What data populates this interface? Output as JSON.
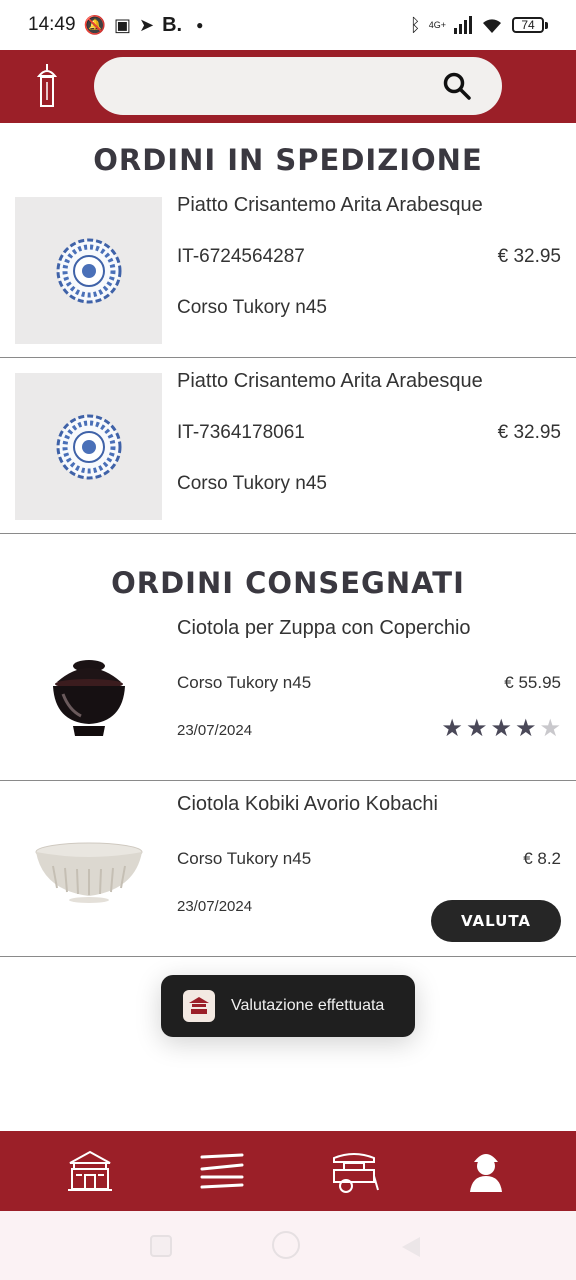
{
  "status_bar": {
    "time": "14:49",
    "network": "4G+",
    "battery": "74"
  },
  "search": {
    "placeholder": ""
  },
  "sections": {
    "shipping_title": "ORDINI IN SPEDIZIONE",
    "delivered_title": "ORDINI CONSEGNATI"
  },
  "shipping_orders": [
    {
      "name": "Piatto Crisantemo Arita Arabesque",
      "code": "IT-6724564287",
      "price": "€ 32.95",
      "address": "Corso Tukory n45"
    },
    {
      "name": "Piatto Crisantemo Arita Arabesque",
      "code": "IT-7364178061",
      "price": "€ 32.95",
      "address": "Corso Tukory n45"
    }
  ],
  "delivered_orders": [
    {
      "name": "Ciotola per Zuppa con Coperchio",
      "address": "Corso Tukory n45",
      "price": "€ 55.95",
      "date": "23/07/2024",
      "rating": 4,
      "rating_max": 5
    },
    {
      "name": "Ciotola Kobiki Avorio Kobachi",
      "address": "Corso Tukory n45",
      "price": "€ 8.2",
      "date": "23/07/2024",
      "rate_button": "VALUTA"
    }
  ],
  "toast": {
    "text": "Valutazione effettuata"
  },
  "colors": {
    "brand_red": "#9b1f28",
    "star_on": "#4a4858",
    "star_off": "#c9c8cc",
    "button_dark": "#262626"
  },
  "icons": {
    "logo": "lantern-logo-icon",
    "search": "search-icon",
    "nav": [
      "house-icon",
      "chopsticks-icon",
      "food-cart-icon",
      "geisha-profile-icon"
    ]
  }
}
